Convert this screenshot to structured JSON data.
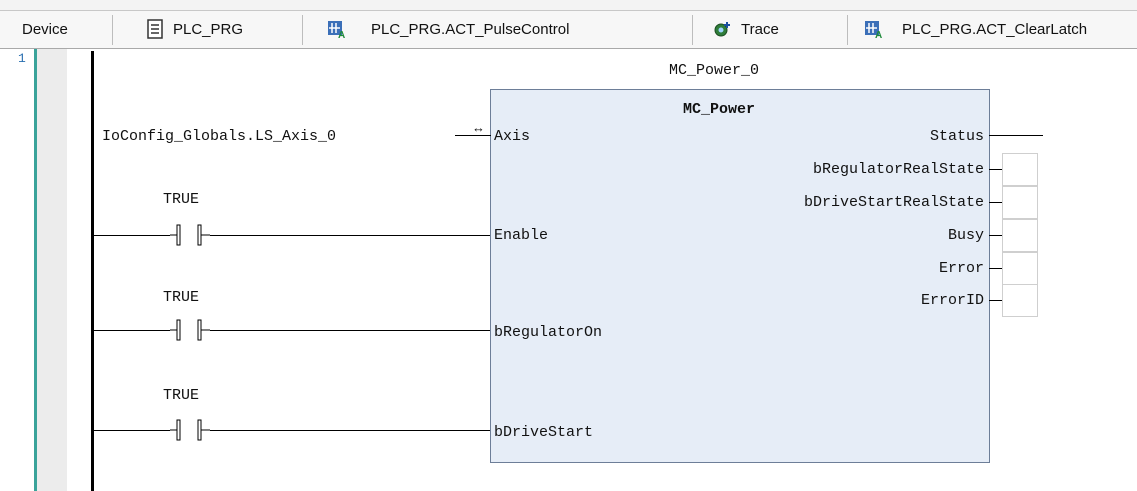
{
  "tabs": [
    {
      "label": "Device",
      "icon": ""
    },
    {
      "label": "PLC_PRG",
      "icon": "document-icon"
    },
    {
      "label": "PLC_PRG.ACT_PulseControl",
      "icon": "action-icon"
    },
    {
      "label": "Trace",
      "icon": "trace-icon"
    },
    {
      "label": "PLC_PRG.ACT_ClearLatch",
      "icon": "action-icon"
    }
  ],
  "editor": {
    "line_number": "1",
    "instance_name": "MC_Power_0",
    "block_type": "MC_Power",
    "axis_variable": "IoConfig_Globals.LS_Axis_0",
    "axis_arrow": "↔",
    "inputs": [
      "Axis",
      "Enable",
      "bRegulatorOn",
      "bDriveStart"
    ],
    "outputs": [
      "Status",
      "bRegulatorRealState",
      "bDriveStartRealState",
      "Busy",
      "Error",
      "ErrorID"
    ],
    "contacts": [
      {
        "label": "TRUE"
      },
      {
        "label": "TRUE"
      },
      {
        "label": "TRUE"
      }
    ]
  },
  "colors": {
    "block_fill": "#e6edf7",
    "block_border": "#6d7e98",
    "gutter_accent": "#3aa39a"
  }
}
